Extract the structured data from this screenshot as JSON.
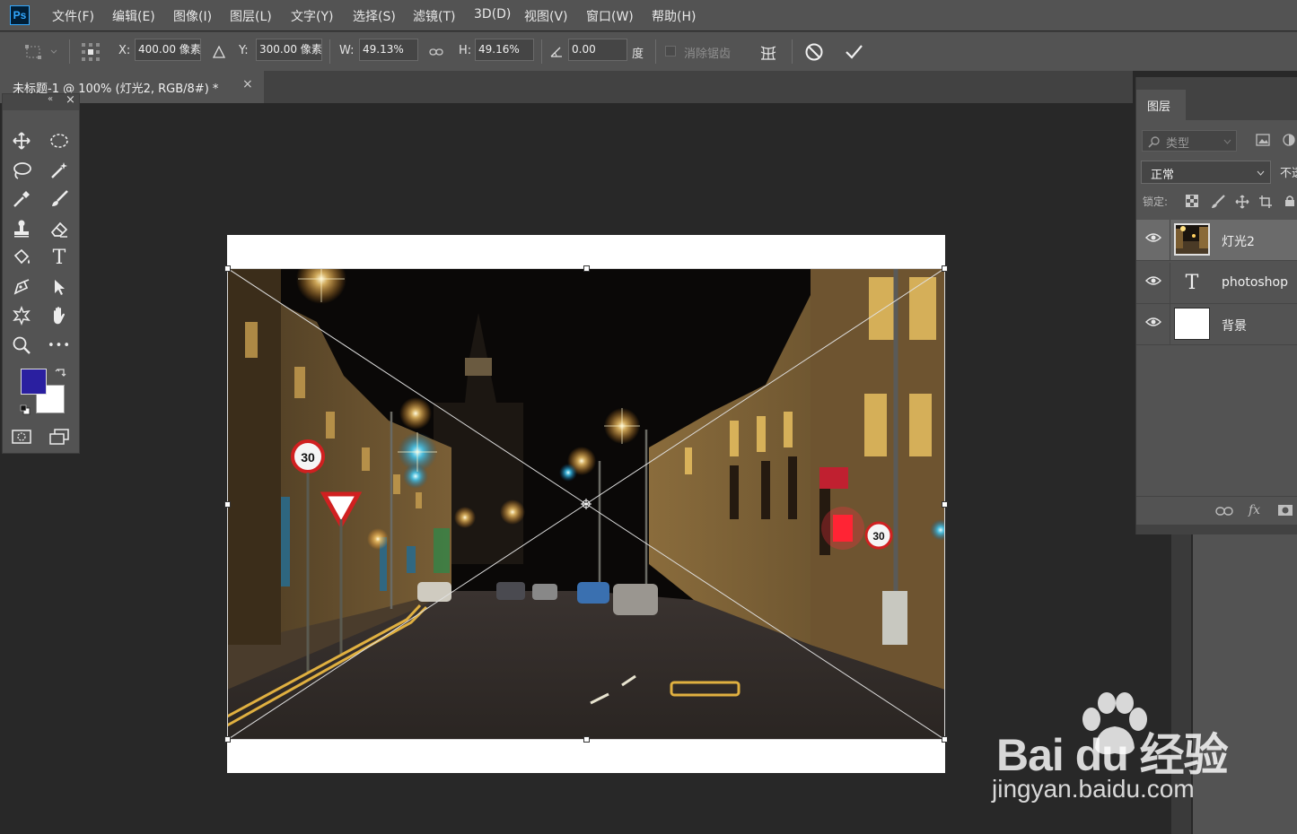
{
  "app": {
    "logo": "Ps",
    "menu": [
      "文件(F)",
      "编辑(E)",
      "图像(I)",
      "图层(L)",
      "文字(Y)",
      "选择(S)",
      "滤镜(T)",
      "3D(D)",
      "视图(V)",
      "窗口(W)",
      "帮助(H)"
    ]
  },
  "options": {
    "x_label": "X:",
    "x_value": "400.00 像素",
    "y_label": "Y:",
    "y_value": "300.00 像素",
    "w_label": "W:",
    "w_value": "49.13%",
    "h_label": "H:",
    "h_value": "49.16%",
    "angle_value": "0.00",
    "angle_unit": "度",
    "antialias_label": "消除锯齿"
  },
  "document": {
    "tab_title": "未标题-1 @ 100% (灯光2, RGB/8#) *",
    "close_glyph": "×"
  },
  "toolbar": {
    "collapse_glyph": "«",
    "close_glyph": "×",
    "foreground_color": "#2a1fa0",
    "background_color": "#ffffff",
    "text_tool_glyph": "T",
    "more_glyph": "•••"
  },
  "layers_panel": {
    "tab": "图层",
    "filter_placeholder": "类型",
    "blend_mode": "正常",
    "opacity_label": "不透明度:",
    "lock_label": "锁定:",
    "layers": [
      {
        "name": "灯光2",
        "type": "image",
        "selected": true
      },
      {
        "name": "photoshop",
        "type": "text",
        "selected": false
      },
      {
        "name": "背景",
        "type": "fill",
        "selected": false
      }
    ],
    "text_layer_glyph": "T",
    "footer_fx": "fx"
  },
  "watermark": {
    "brand": "Bai du 经验",
    "url": "jingyan.baidu.com"
  }
}
